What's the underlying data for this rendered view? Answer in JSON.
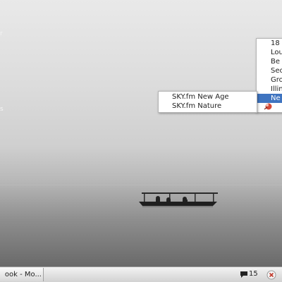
{
  "desktop": {
    "left_edge_texts": [
      "r",
      "s"
    ]
  },
  "menu": {
    "items": [
      {
        "label": "18",
        "selected": false
      },
      {
        "label": "Lou",
        "selected": false
      },
      {
        "label": "Be",
        "selected": false
      },
      {
        "label": "Sec",
        "selected": false
      },
      {
        "label": "Gro",
        "selected": false
      },
      {
        "label": "Illin",
        "selected": false
      },
      {
        "label": "Ne",
        "selected": true
      }
    ],
    "selected_color": "#3f74c0"
  },
  "submenu": {
    "items": [
      "SKY.fm New Age",
      "SKY.fm Nature"
    ]
  },
  "taskbar": {
    "window_button": "ook - Mo...",
    "chat_count": "15"
  }
}
